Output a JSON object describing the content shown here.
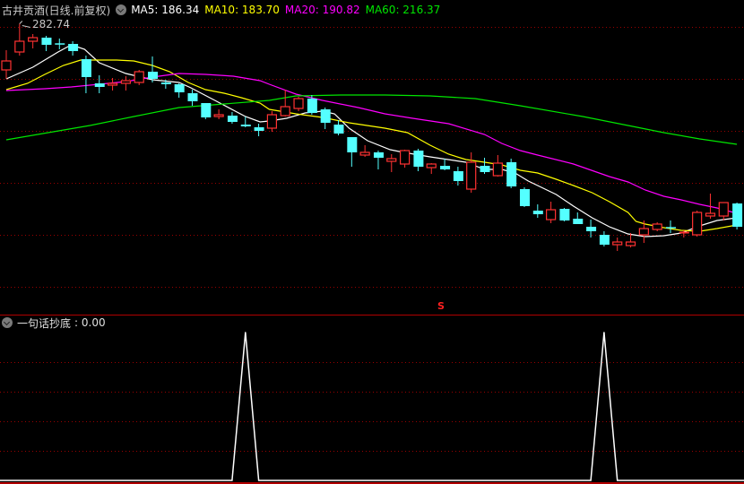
{
  "header": {
    "title": "古井贡酒(日线.前复权)",
    "ma5": "MA5: 186.34",
    "ma10": "MA10: 183.70",
    "ma20": "MA20: 190.82",
    "ma60": "MA60: 216.37"
  },
  "high_marker": "282.74",
  "signal_marker": "S",
  "lower_pane": {
    "name": "一句话抄底",
    "value": ": 0.00"
  },
  "colors": {
    "up": "#ff3232",
    "down": "#54ffff",
    "ma5": "#ffffff",
    "ma10": "#ffff00",
    "ma20": "#ff00ff",
    "ma60": "#00e600",
    "grid": "#9a0000",
    "separator": "#b00000"
  },
  "chart_data": [
    {
      "type": "candlestick",
      "title": "古井贡酒(日线.前复权)",
      "fields": [
        "open",
        "high",
        "low",
        "close"
      ],
      "candles": [
        [
          257,
          268,
          252,
          262
        ],
        [
          267,
          282.74,
          265,
          273
        ],
        [
          273,
          277,
          269,
          275
        ],
        [
          275,
          276,
          267.5,
          271
        ],
        [
          271.6,
          274.5,
          268.5,
          271.4
        ],
        [
          271.5,
          273,
          265,
          267.5
        ],
        [
          263,
          265,
          244,
          253
        ],
        [
          249.5,
          254,
          244,
          247.5
        ],
        [
          248.5,
          252.5,
          245.5,
          249.5
        ],
        [
          249.5,
          253.5,
          245.5,
          251
        ],
        [
          250,
          257,
          248.5,
          256
        ],
        [
          256,
          264.5,
          250,
          252
        ],
        [
          250,
          251.5,
          246.5,
          249
        ],
        [
          249,
          249.5,
          241.5,
          244.5
        ],
        [
          244,
          246,
          237,
          239.5
        ],
        [
          238.5,
          238.5,
          229.5,
          230.5
        ],
        [
          231,
          235,
          229.5,
          232
        ],
        [
          231.5,
          233.5,
          227,
          228
        ],
        [
          226.5,
          231,
          225,
          225.5
        ],
        [
          225,
          227,
          220,
          223
        ],
        [
          224.5,
          234,
          222.5,
          232
        ],
        [
          231.5,
          246,
          231,
          236.5
        ],
        [
          235.5,
          242,
          234,
          241
        ],
        [
          241,
          243,
          232,
          233
        ],
        [
          235,
          236,
          224,
          227.5
        ],
        [
          226.5,
          229,
          220.5,
          221.5
        ],
        [
          219.5,
          219.5,
          203,
          211
        ],
        [
          209.5,
          215,
          208.5,
          211
        ],
        [
          211,
          212,
          201.5,
          208
        ],
        [
          206,
          210,
          200,
          207.5
        ],
        [
          204.5,
          212.5,
          202.5,
          212
        ],
        [
          212,
          213,
          200.5,
          203
        ],
        [
          202.5,
          205,
          199,
          204.5
        ],
        [
          203.5,
          207.5,
          201,
          201.5
        ],
        [
          200.5,
          203,
          192.5,
          195
        ],
        [
          190.5,
          211,
          188.5,
          205.5
        ],
        [
          203.5,
          208,
          199,
          200
        ],
        [
          198,
          209.5,
          197.5,
          205
        ],
        [
          205.5,
          207.5,
          191,
          192
        ],
        [
          190.5,
          191.5,
          180.5,
          181
        ],
        [
          178.5,
          182,
          174.5,
          176.5
        ],
        [
          173.5,
          183.5,
          171.5,
          179
        ],
        [
          179.5,
          180,
          172.5,
          173
        ],
        [
          174,
          177.5,
          171,
          171
        ],
        [
          169.5,
          173.5,
          163.5,
          167
        ],
        [
          165,
          167,
          158.5,
          159.5
        ],
        [
          159.5,
          163.5,
          156,
          161
        ],
        [
          159,
          166,
          158,
          161
        ],
        [
          165,
          173,
          160.5,
          168.5
        ],
        [
          168,
          172,
          167,
          171
        ],
        [
          169.1,
          173,
          166,
          168.9
        ],
        [
          166,
          167.5,
          163.5,
          166.5
        ],
        [
          165,
          178.5,
          164,
          177.5
        ],
        [
          175.5,
          188,
          174,
          177
        ],
        [
          175.5,
          183,
          173,
          183
        ],
        [
          182.5,
          183,
          168,
          169.5
        ]
      ],
      "moving_averages": [
        {
          "name": "MA5",
          "color_key": "ma5",
          "points": [
            [
              0,
              252
            ],
            [
              2,
              258.5
            ],
            [
              3.9,
              267
            ],
            [
              4.9,
              271
            ],
            [
              5.9,
              268.5
            ],
            [
              7,
              261
            ],
            [
              9,
              255
            ],
            [
              11,
              251.5
            ],
            [
              13,
              250
            ],
            [
              13.9,
              247
            ],
            [
              15.7,
              240
            ],
            [
              18,
              231
            ],
            [
              19.1,
              228
            ],
            [
              19.8,
              228.5
            ],
            [
              21.1,
              230
            ],
            [
              22.5,
              233
            ],
            [
              23.8,
              234
            ],
            [
              24.7,
              232.5
            ],
            [
              25.8,
              224.5
            ],
            [
              27.2,
              217.5
            ],
            [
              28.9,
              212.5
            ],
            [
              29.9,
              211
            ],
            [
              31.9,
              208.5
            ],
            [
              34.6,
              205.5
            ],
            [
              36,
              201.5
            ],
            [
              37.3,
              201.5
            ],
            [
              38.3,
              199.5
            ],
            [
              39.3,
              195
            ],
            [
              40,
              192.5
            ],
            [
              41.4,
              187.5
            ],
            [
              42.7,
              181
            ],
            [
              44.1,
              174.5
            ],
            [
              45.4,
              169.5
            ],
            [
              46.8,
              165.5
            ],
            [
              48.1,
              164
            ],
            [
              49.5,
              164.5
            ],
            [
              50.8,
              166
            ],
            [
              52.2,
              170
            ],
            [
              53.5,
              173
            ],
            [
              55,
              174.5
            ]
          ]
        },
        {
          "name": "MA10",
          "color_key": "ma10",
          "points": [
            [
              0,
              246
            ],
            [
              1.6,
              249.5
            ],
            [
              2.9,
              254.5
            ],
            [
              4.3,
              259.5
            ],
            [
              5.6,
              262.5
            ],
            [
              8.3,
              262.5
            ],
            [
              9.6,
              262
            ],
            [
              11,
              259.5
            ],
            [
              12.3,
              256
            ],
            [
              13.7,
              250
            ],
            [
              15,
              246
            ],
            [
              16.4,
              244
            ],
            [
              17.7,
              241.5
            ],
            [
              19.1,
              238.5
            ],
            [
              19.8,
              235
            ],
            [
              21.8,
              232.5
            ],
            [
              23.8,
              230.5
            ],
            [
              25.8,
              227.5
            ],
            [
              28.5,
              224.5
            ],
            [
              30.2,
              222
            ],
            [
              31.9,
              215
            ],
            [
              33.3,
              210
            ],
            [
              34.6,
              207
            ],
            [
              36,
              205.5
            ],
            [
              37.3,
              204
            ],
            [
              38.7,
              201
            ],
            [
              40,
              199.5
            ],
            [
              41.4,
              196
            ],
            [
              42.7,
              192.5
            ],
            [
              44.1,
              188.5
            ],
            [
              45.4,
              183.5
            ],
            [
              46.8,
              177.5
            ],
            [
              47.4,
              172.5
            ],
            [
              48.1,
              171
            ],
            [
              49.5,
              169
            ],
            [
              50.8,
              167.5
            ],
            [
              52.2,
              167
            ],
            [
              53.5,
              168.5
            ],
            [
              55,
              170.5
            ]
          ]
        },
        {
          "name": "MA20",
          "color_key": "ma20",
          "points": [
            [
              0,
              245.5
            ],
            [
              2.9,
              246.5
            ],
            [
              4.9,
              247.5
            ],
            [
              7,
              249
            ],
            [
              9,
              250.5
            ],
            [
              11,
              253
            ],
            [
              13,
              255
            ],
            [
              15,
              254.5
            ],
            [
              17.1,
              253.5
            ],
            [
              19.1,
              251
            ],
            [
              19.8,
              249
            ],
            [
              21.8,
              243.5
            ],
            [
              23.8,
              240
            ],
            [
              26.5,
              236
            ],
            [
              28.5,
              232.5
            ],
            [
              30.6,
              230
            ],
            [
              33.3,
              227
            ],
            [
              36,
              221
            ],
            [
              37.3,
              216
            ],
            [
              38.7,
              212
            ],
            [
              40,
              209.5
            ],
            [
              42.7,
              204.5
            ],
            [
              45.4,
              197.5
            ],
            [
              46.8,
              194.5
            ],
            [
              48.1,
              190
            ],
            [
              49.5,
              186.5
            ],
            [
              50.8,
              184.5
            ],
            [
              52.2,
              182
            ],
            [
              53.5,
              180
            ],
            [
              55,
              177
            ]
          ]
        },
        {
          "name": "MA60",
          "color_key": "ma60",
          "points": [
            [
              0,
              218
            ],
            [
              6.3,
              226
            ],
            [
              9.6,
              231
            ],
            [
              13,
              236
            ],
            [
              16.4,
              238
            ],
            [
              19.8,
              240
            ],
            [
              21.8,
              242.5
            ],
            [
              25.2,
              243
            ],
            [
              28.5,
              243
            ],
            [
              31.9,
              242.5
            ],
            [
              35.3,
              241
            ],
            [
              38.7,
              237
            ],
            [
              43.4,
              231
            ],
            [
              46.8,
              226
            ],
            [
              49.5,
              222
            ],
            [
              52.2,
              218.5
            ],
            [
              55,
              215.5
            ]
          ]
        }
      ],
      "high_marker_index": 1,
      "signal_index": 33,
      "grid": true
    },
    {
      "type": "line",
      "title": "一句话抄底",
      "values": [
        0,
        0,
        0,
        0,
        0,
        0,
        0,
        0,
        0,
        0,
        0,
        0,
        0,
        0,
        0,
        0,
        0,
        0,
        1,
        0,
        0,
        0,
        0,
        0,
        0,
        0,
        0,
        0,
        0,
        0,
        0,
        0,
        0,
        0,
        0,
        0,
        0,
        0,
        0,
        0,
        0,
        0,
        0,
        0,
        0,
        1,
        0,
        0,
        0,
        0,
        0,
        0,
        0,
        0,
        0,
        0
      ],
      "ylim": [
        0,
        1
      ],
      "grid": true
    }
  ]
}
